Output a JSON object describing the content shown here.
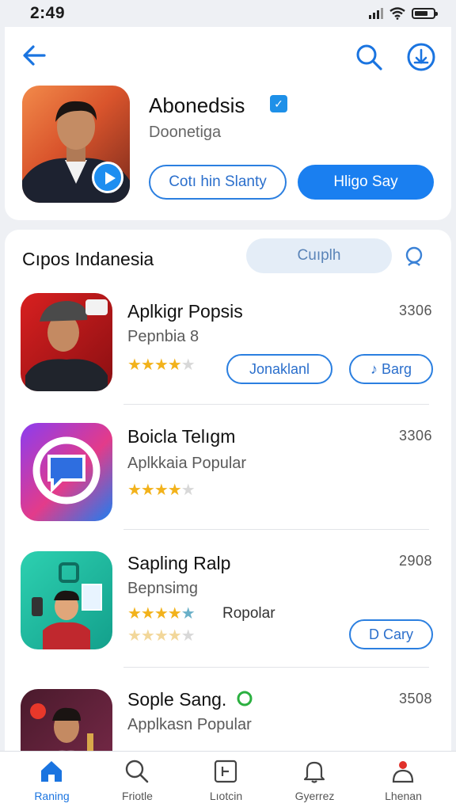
{
  "status_bar": {
    "time": "2:49"
  },
  "header": {
    "developer_name": "Abonedsis",
    "developer_subtitle": "Doonetiga",
    "outline_button": "Cotı hin Slanty",
    "primary_button": "Hligo Say",
    "verified_badge": "✓"
  },
  "section": {
    "title": "Cıpos Indanesia",
    "pill_button": "Cuıplh"
  },
  "apps": [
    {
      "name": "Aplkigr Popsis",
      "subtitle": "Pepnbia 8",
      "count": "3306",
      "rating": 4.5,
      "action1": "Jonaklanl",
      "action2": "♪ Barg"
    },
    {
      "name": "Boicla Telıgm",
      "subtitle": "Aplkkaia Popular",
      "count": "3306",
      "rating": 4.0
    },
    {
      "name": "Sapling Ralp",
      "subtitle": "Bepnsimg",
      "count": "2908",
      "rating": 5.0,
      "rating_label": "Ropolar",
      "rating_secondary": 4.0,
      "action": "D Cary"
    },
    {
      "name": "Sople Sang.",
      "subtitle": "Applkasn Popular",
      "count": "3508"
    }
  ],
  "tabs": [
    {
      "label": "Raning",
      "icon": "home-icon",
      "active": true
    },
    {
      "label": "Friotle",
      "icon": "search-icon"
    },
    {
      "label": "Lıotcin",
      "icon": "square-grid-icon"
    },
    {
      "label": "Gyerrez",
      "icon": "bell-icon"
    },
    {
      "label": "Lhenan",
      "icon": "profile-icon"
    }
  ],
  "colors": {
    "accent": "#1a7ff0",
    "star": "#f2b21b",
    "background": "#eef0f4"
  }
}
